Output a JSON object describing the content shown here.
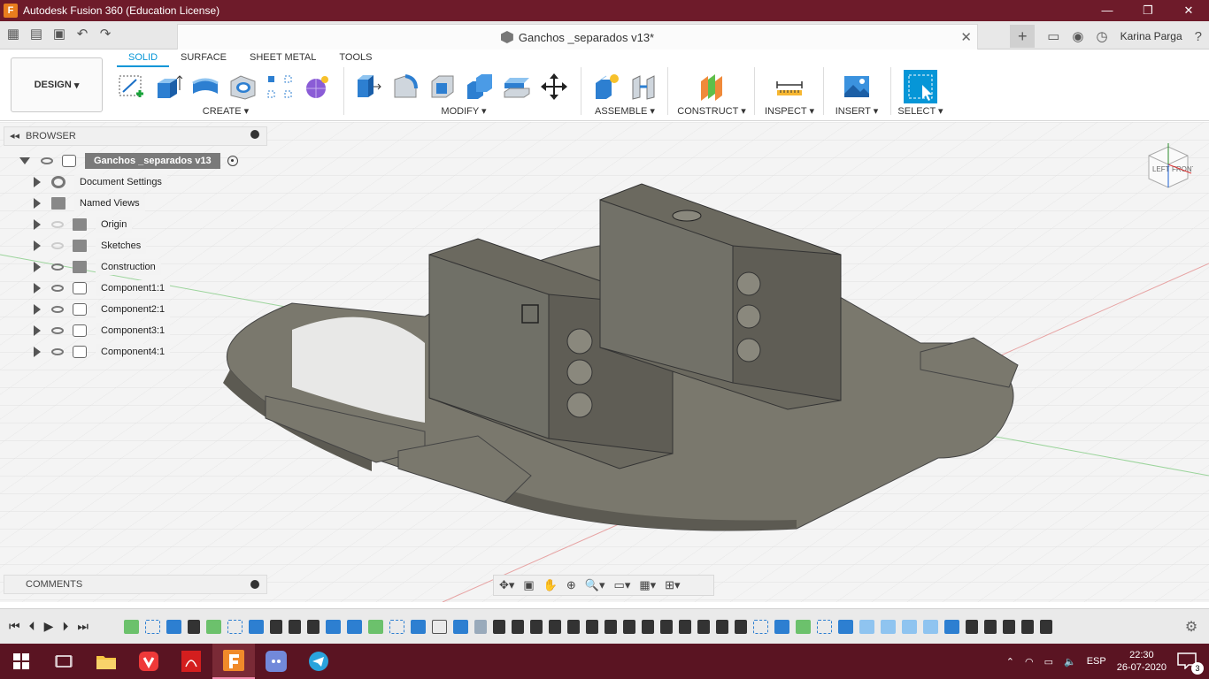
{
  "window": {
    "title": "Autodesk Fusion 360 (Education License)",
    "controls": [
      "—",
      "❐",
      "✕"
    ]
  },
  "tabs": {
    "document": "Ganchos _separados v13*",
    "user": "Karina Parga"
  },
  "ribbon": {
    "workspace": "DESIGN",
    "tabs": [
      "SOLID",
      "SURFACE",
      "SHEET METAL",
      "TOOLS"
    ],
    "groups": {
      "create": "CREATE",
      "modify": "MODIFY",
      "assemble": "ASSEMBLE",
      "construct": "CONSTRUCT",
      "inspect": "INSPECT",
      "insert": "INSERT",
      "select": "SELECT"
    }
  },
  "browser": {
    "label": "BROWSER",
    "root": "Ganchos _separados v13",
    "items": [
      {
        "label": "Document Settings"
      },
      {
        "label": "Named Views"
      },
      {
        "label": "Origin"
      },
      {
        "label": "Sketches"
      },
      {
        "label": "Construction"
      },
      {
        "label": "Component1:1"
      },
      {
        "label": "Component2:1"
      },
      {
        "label": "Component3:1"
      },
      {
        "label": "Component4:1"
      }
    ]
  },
  "comments": {
    "label": "COMMENTS"
  },
  "viewcube": {
    "left": "LEFT",
    "front": "FRONT"
  },
  "taskbar": {
    "language": "ESP",
    "time": "22:30",
    "date": "26-07-2020",
    "notifications": "3"
  }
}
